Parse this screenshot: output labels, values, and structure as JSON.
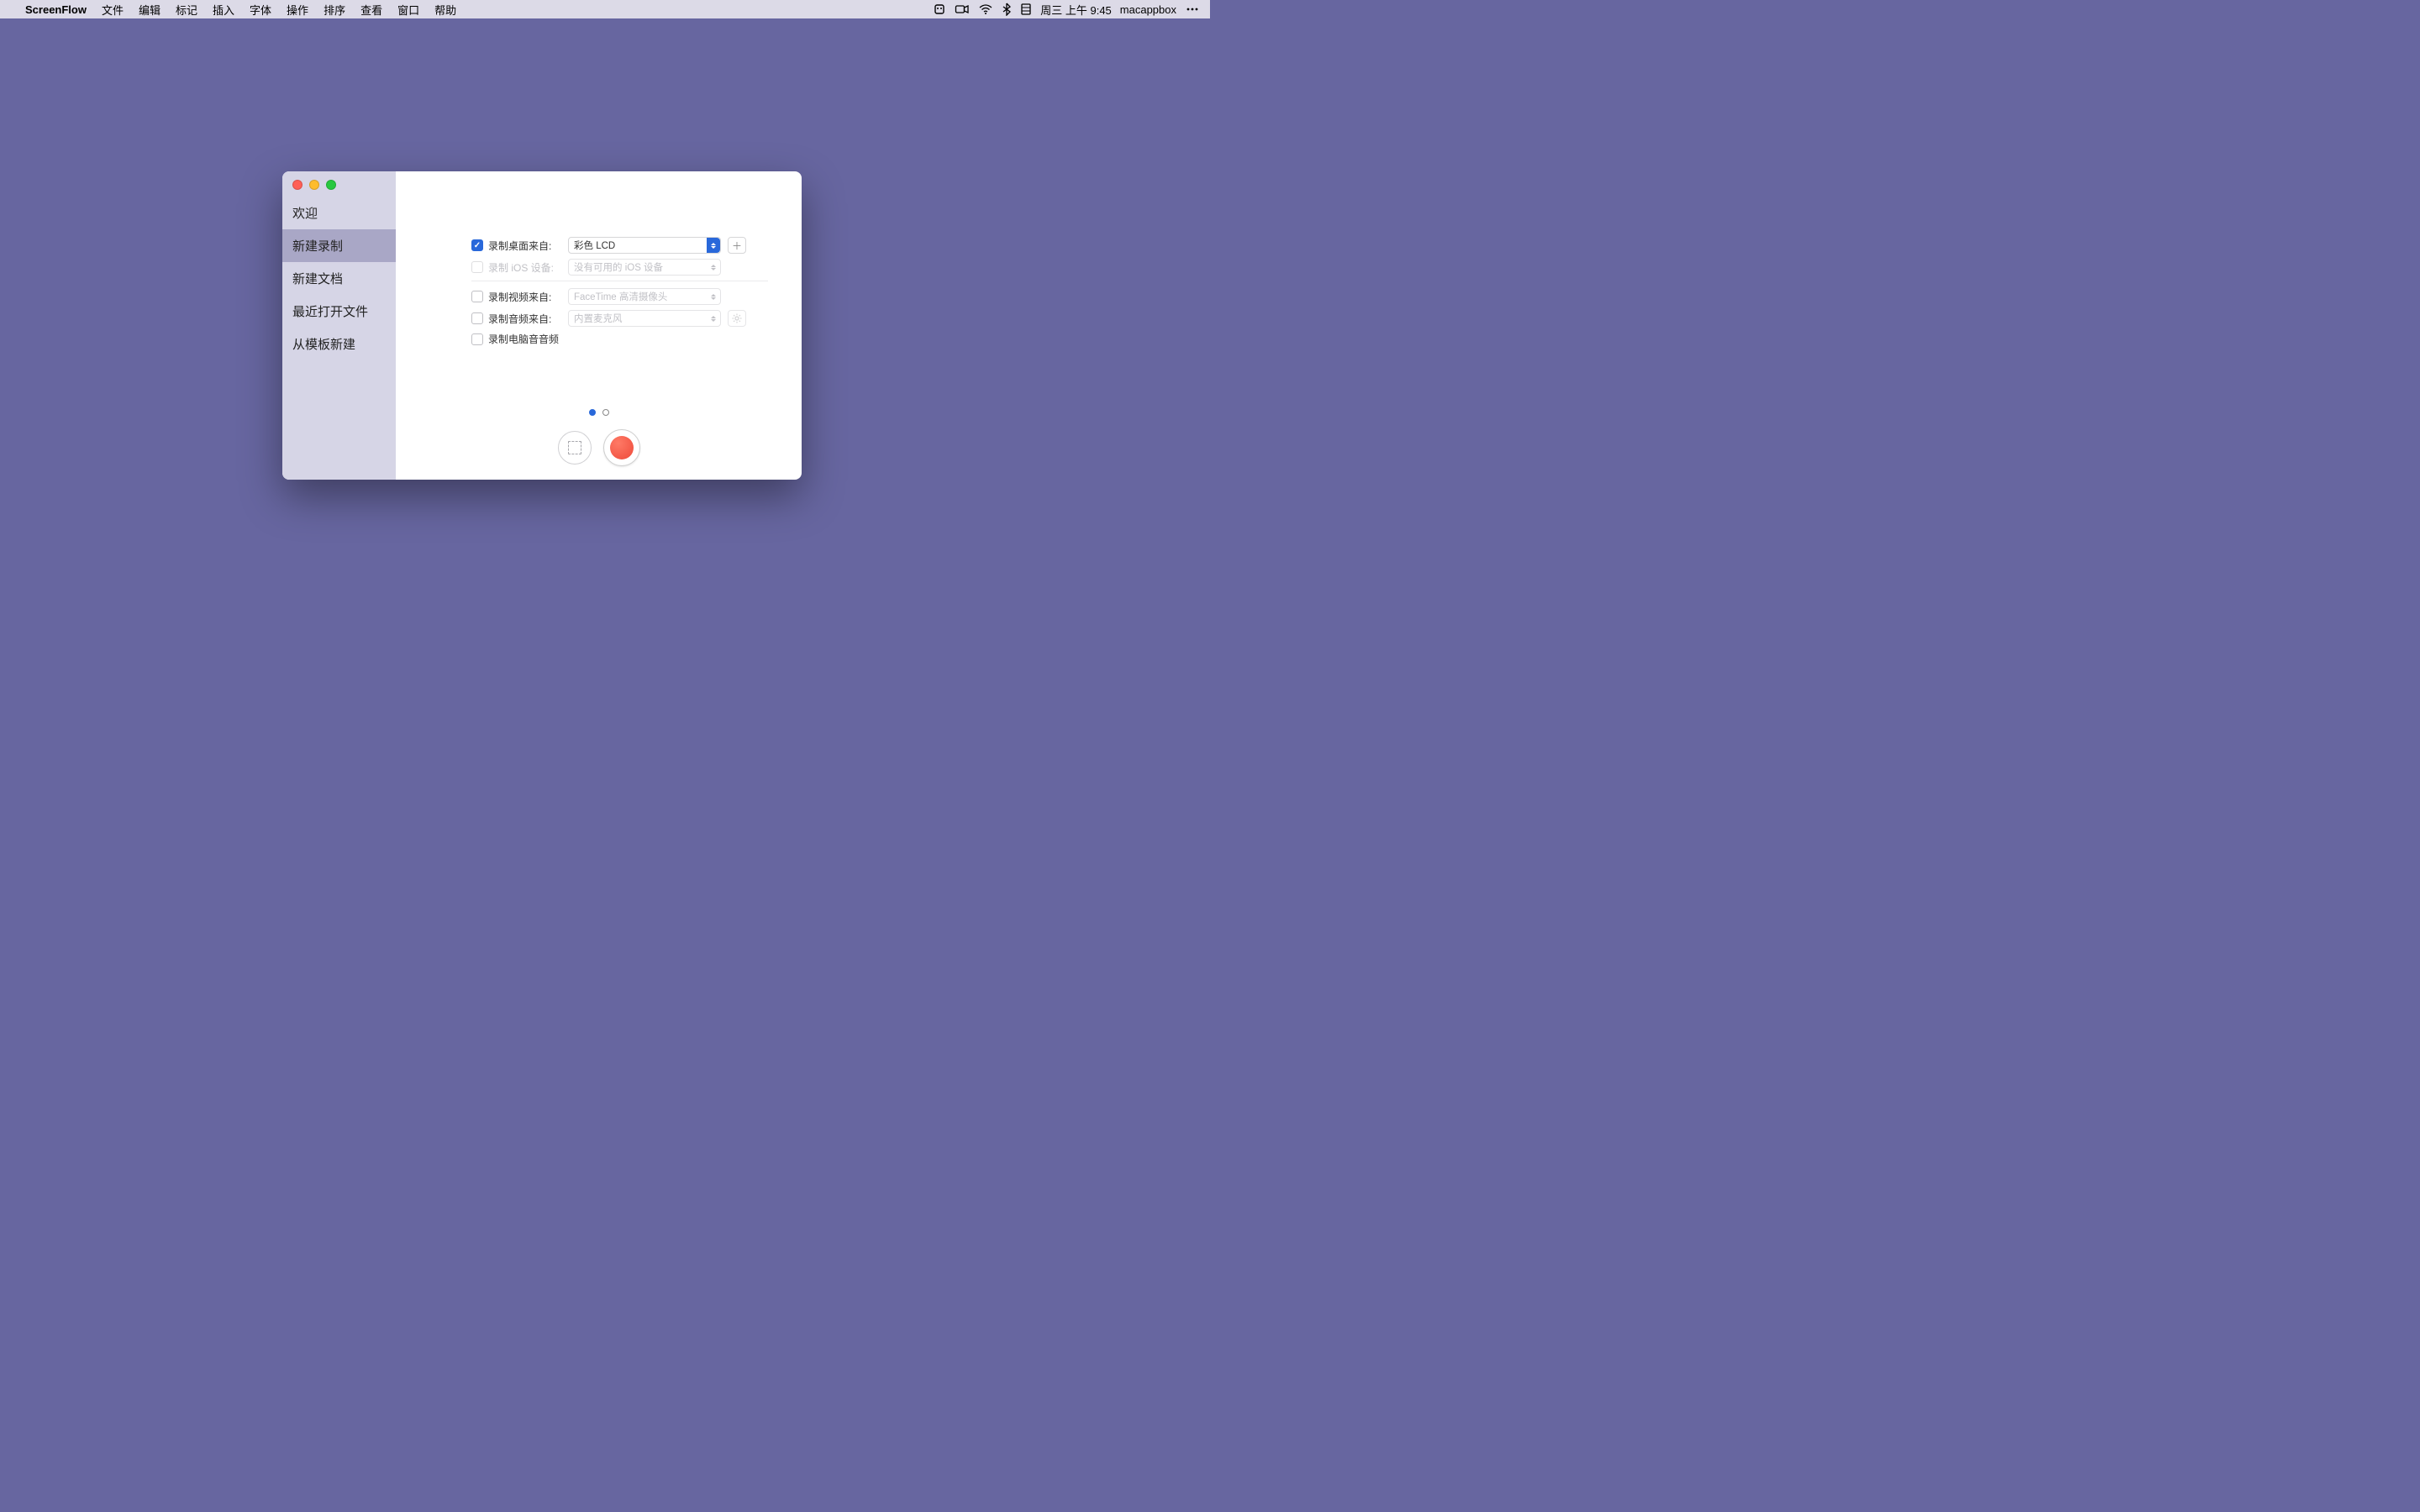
{
  "menubar": {
    "app": "ScreenFlow",
    "items": [
      "文件",
      "编辑",
      "标记",
      "插入",
      "字体",
      "操作",
      "排序",
      "查看",
      "窗口",
      "帮助"
    ],
    "clock": "周三 上午 9:45",
    "user": "macappbox"
  },
  "sidebar": {
    "items": [
      "欢迎",
      "新建录制",
      "新建文档",
      "最近打开文件",
      "从模板新建"
    ],
    "activeIndex": 1
  },
  "form": {
    "desktop": {
      "label": "录制桌面来自:",
      "value": "彩色 LCD"
    },
    "ios": {
      "label": "录制 iOS 设备:",
      "value": "没有可用的 iOS 设备"
    },
    "video": {
      "label": "录制视频来自:",
      "value": "FaceTime 高清摄像头"
    },
    "audio": {
      "label": "录制音频来自:",
      "value": "内置麦克风"
    },
    "computerAudio": {
      "label": "录制电脑音音频"
    }
  }
}
